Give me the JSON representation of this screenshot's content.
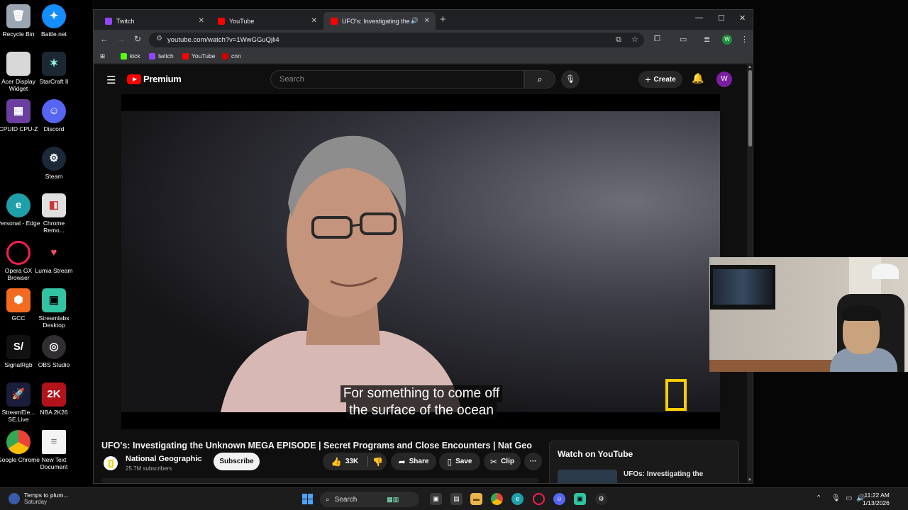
{
  "desktop": {
    "icons": [
      {
        "label": "Recycle Bin"
      },
      {
        "label": "Battle.net"
      },
      {
        "label": "Acer Display Widget"
      },
      {
        "label": "StarCraft II"
      },
      {
        "label": "CPUID CPU-Z"
      },
      {
        "label": "Discord"
      },
      {
        "label": "Steam"
      },
      {
        "label": "Personal - Edge"
      },
      {
        "label": "Chrome Remo..."
      },
      {
        "label": "Opera GX Browser"
      },
      {
        "label": "Lumia Stream"
      },
      {
        "label": "GCC"
      },
      {
        "label": "Streamlabs Desktop"
      },
      {
        "label": "SignalRgb"
      },
      {
        "label": "OBS Studio"
      },
      {
        "label": "StreamEle... SE.Live"
      },
      {
        "label": "NBA 2K26"
      },
      {
        "label": "Google Chrome"
      },
      {
        "label": "New Text Document"
      }
    ]
  },
  "browser": {
    "tabs": [
      {
        "label": "Twitch",
        "color": "#9146ff"
      },
      {
        "label": "YouTube",
        "color": "#ff0000"
      },
      {
        "label": "UFO's: Investigating the Un",
        "color": "#ff0000",
        "active": true
      }
    ],
    "url": "youtube.com/watch?v=1WwGGuQjli4",
    "bookmarks": [
      {
        "label": "kick",
        "color": "#53fc18"
      },
      {
        "label": "twitch",
        "color": "#9146ff"
      },
      {
        "label": "YouTube",
        "color": "#ff0000"
      },
      {
        "label": "cnn",
        "color": "#cc0000"
      }
    ],
    "profile_initial": "W"
  },
  "youtube": {
    "logo_text": "Premium",
    "search_placeholder": "Search",
    "create_label": "Create",
    "avatar_initial": "W",
    "caption_line1": "For something to come off",
    "caption_line2": "the surface of the ocean",
    "video_title": "UFO's: Investigating the Unknown MEGA EPISODE | Secret Programs and Close Encounters | Nat Geo",
    "channel_name": "National Geographic",
    "subscribers": "25.7M subscribers",
    "subscribe_label": "Subscribe",
    "likes": "33K",
    "share_label": "Share",
    "save_label": "Save",
    "clip_label": "Clip",
    "watch_on_youtube": "Watch on YouTube",
    "next_title": "UFOs: Investigating the"
  },
  "taskbar": {
    "weather_line1": "Temps to plum...",
    "weather_line2": "Saturday",
    "search_label": "Search",
    "time": "11:22 AM",
    "date": "1/13/2026"
  }
}
